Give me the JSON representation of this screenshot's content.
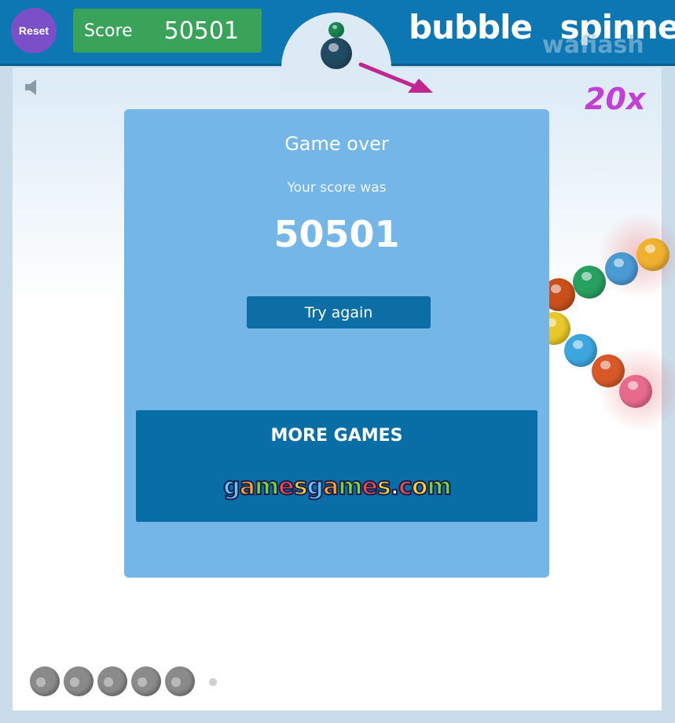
{
  "header": {
    "reset_label": "Reset",
    "score_label": "Score",
    "score_value": "50501",
    "logo_word1": "bubble",
    "logo_word2": "spinner",
    "logo_sub": "wafiash"
  },
  "hud": {
    "multiplier": "20x",
    "sound_icon": "speaker-icon",
    "lives_remaining": 5
  },
  "dialog": {
    "title": "Game over",
    "subtitle": "Your score was",
    "score": "50501",
    "try_again_label": "Try again",
    "more_games_title": "MORE GAMES",
    "more_games_logo": "gamesgames.com"
  },
  "bubbles": {
    "launcher": [
      "#1b8a55",
      "#234a63"
    ],
    "field": [
      "#f0b030",
      "#4a9ad4",
      "#27a060",
      "#c9501a",
      "#e8c82a",
      "#3da6de",
      "#d9582a",
      "#e86b8c"
    ]
  },
  "colors": {
    "topbar": "#0d77b3",
    "score_box": "#3aa35a",
    "reset_button": "#7a4fc7",
    "panel": "#73b6e7",
    "panel_dark": "#0a6ea6",
    "multiplier": "#c23fd8"
  }
}
